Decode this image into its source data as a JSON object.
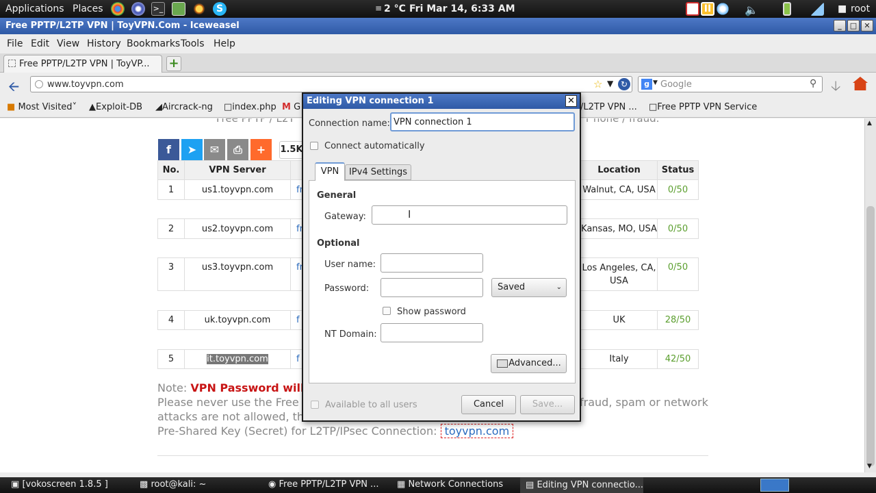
{
  "top_panel": {
    "applications": "Applications",
    "places": "Places",
    "weather": "2 °C",
    "clock": "Fri Mar 14,  6:33 AM",
    "user": "root"
  },
  "window": {
    "title": "Free PPTP/L2TP VPN | ToyVPN.Com - Iceweasel"
  },
  "menu": [
    "File",
    "Edit",
    "View",
    "History",
    "Bookmarks",
    "Tools",
    "Help"
  ],
  "tab": {
    "label": "Free PPTP/L2TP VPN | ToyVP..."
  },
  "url": {
    "value": "www.toyvpn.com"
  },
  "search": {
    "placeholder": "Google"
  },
  "bookmarks": [
    "Most Visited",
    "Exploit-DB",
    "Aircrack-ng",
    "index.php",
    "G",
    "/L2TP VPN ...",
    "Free PPTP VPN Service"
  ],
  "page": {
    "top_text_left": "Free PPTP / L2T",
    "top_text_right": "r none / fraud.",
    "share_count": "1.5K",
    "table": {
      "headers": {
        "no": "No.",
        "server": "VPN Server",
        "location": "Location",
        "status": "Status"
      },
      "rows": [
        {
          "no": "1",
          "server": "us1.toyvpn.com",
          "frag": "fr",
          "location": "Walnut, CA, USA",
          "status": "0/50"
        },
        {
          "no": "2",
          "server": "us2.toyvpn.com",
          "frag": "fr",
          "location": "Kansas, MO, USA",
          "status": "0/50"
        },
        {
          "no": "3",
          "server": "us3.toyvpn.com",
          "frag": "fr",
          "location": "Los Angeles, CA, USA",
          "status": "0/50"
        },
        {
          "no": "4",
          "server": "uk.toyvpn.com",
          "frag": "f",
          "location": "UK",
          "status": "28/50"
        },
        {
          "no": "5",
          "server": "it.toyvpn.com",
          "frag": "f",
          "location": "Italy",
          "status": "42/50"
        }
      ]
    },
    "note_label": "Note:",
    "note_red": "VPN Password will be",
    "line2_left": "Please never use the Free V",
    "line2_right": "fraud, spam or network",
    "line3_left": "attacks are not allowed, th",
    "psk_label": "Pre-Shared Key (Secret) for L2TP/IPsec Connection:",
    "psk_value": "toyvpn.com"
  },
  "dialog": {
    "title": "Editing VPN connection 1",
    "connection_name_label": "Connection name:",
    "connection_name_value": "VPN connection 1",
    "connect_automatically": "Connect automatically",
    "tabs": [
      "VPN",
      "IPv4 Settings"
    ],
    "general_heading": "General",
    "gateway_label": "Gateway:",
    "optional_heading": "Optional",
    "username_label": "User name:",
    "password_label": "Password:",
    "password_mode": "Saved",
    "show_password": "Show password",
    "nt_domain_label": "NT Domain:",
    "advanced_button": "Advanced...",
    "available_all_users": "Available to all users",
    "cancel_button": "Cancel",
    "save_button": "Save..."
  },
  "taskbar": {
    "items": [
      "[vokoscreen 1.8.5 ]",
      "root@kali: ~",
      "Free PPTP/L2TP VPN ...",
      "Network Connections",
      "Editing VPN connectio..."
    ]
  },
  "colors": {
    "titlebar": "#3b66b6",
    "status_green": "#5a9e2d",
    "note_red": "#c81414",
    "link_blue": "#2a6bbf"
  }
}
